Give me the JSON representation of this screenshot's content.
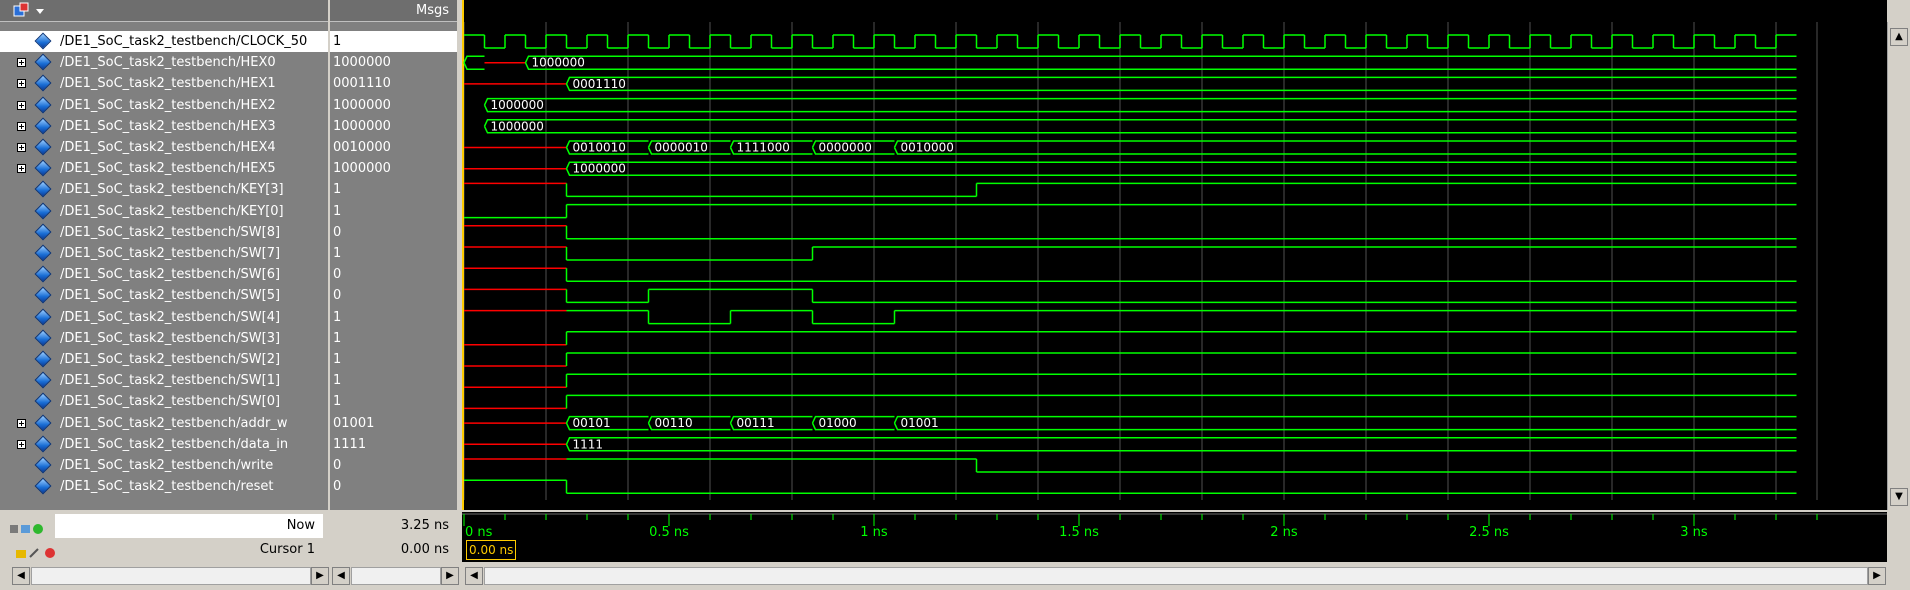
{
  "header": {
    "msgs_label": "Msgs"
  },
  "signals": [
    {
      "name": "/DE1_SoC_task2_testbench/CLOCK_50",
      "value": "1",
      "expandable": false,
      "selected": true
    },
    {
      "name": "/DE1_SoC_task2_testbench/HEX0",
      "value": "1000000",
      "expandable": true
    },
    {
      "name": "/DE1_SoC_task2_testbench/HEX1",
      "value": "0001110",
      "expandable": true
    },
    {
      "name": "/DE1_SoC_task2_testbench/HEX2",
      "value": "1000000",
      "expandable": true
    },
    {
      "name": "/DE1_SoC_task2_testbench/HEX3",
      "value": "1000000",
      "expandable": true
    },
    {
      "name": "/DE1_SoC_task2_testbench/HEX4",
      "value": "0010000",
      "expandable": true
    },
    {
      "name": "/DE1_SoC_task2_testbench/HEX5",
      "value": "1000000",
      "expandable": true
    },
    {
      "name": "/DE1_SoC_task2_testbench/KEY[3]",
      "value": "1",
      "expandable": false
    },
    {
      "name": "/DE1_SoC_task2_testbench/KEY[0]",
      "value": "1",
      "expandable": false
    },
    {
      "name": "/DE1_SoC_task2_testbench/SW[8]",
      "value": "0",
      "expandable": false
    },
    {
      "name": "/DE1_SoC_task2_testbench/SW[7]",
      "value": "1",
      "expandable": false
    },
    {
      "name": "/DE1_SoC_task2_testbench/SW[6]",
      "value": "0",
      "expandable": false
    },
    {
      "name": "/DE1_SoC_task2_testbench/SW[5]",
      "value": "0",
      "expandable": false
    },
    {
      "name": "/DE1_SoC_task2_testbench/SW[4]",
      "value": "1",
      "expandable": false
    },
    {
      "name": "/DE1_SoC_task2_testbench/SW[3]",
      "value": "1",
      "expandable": false
    },
    {
      "name": "/DE1_SoC_task2_testbench/SW[2]",
      "value": "1",
      "expandable": false
    },
    {
      "name": "/DE1_SoC_task2_testbench/SW[1]",
      "value": "1",
      "expandable": false
    },
    {
      "name": "/DE1_SoC_task2_testbench/SW[0]",
      "value": "1",
      "expandable": false
    },
    {
      "name": "/DE1_SoC_task2_testbench/addr_w",
      "value": "01001",
      "expandable": true
    },
    {
      "name": "/DE1_SoC_task2_testbench/data_in",
      "value": "1111",
      "expandable": true
    },
    {
      "name": "/DE1_SoC_task2_testbench/write",
      "value": "0",
      "expandable": false
    },
    {
      "name": "/DE1_SoC_task2_testbench/reset",
      "value": "0",
      "expandable": false
    }
  ],
  "bus_labels": {
    "hex0": [
      "1000000"
    ],
    "hex1": [
      "0001110"
    ],
    "hex2": [
      "1000000"
    ],
    "hex3": [
      "1000000"
    ],
    "hex4": [
      "0010010",
      "0000010",
      "1111000",
      "0000000",
      "0010000"
    ],
    "hex5": [
      "1000000"
    ],
    "addr_w": [
      "00101",
      "00110",
      "00111",
      "01000",
      "01001"
    ],
    "data_in": [
      "1111"
    ]
  },
  "status": {
    "now_label": "Now",
    "now_value": "3.25 ns",
    "cursor_label": "Cursor 1",
    "cursor_value": "0.00 ns",
    "cursor_marker": "0.00 ns"
  },
  "time_axis": {
    "ticks": [
      "0 ns",
      "0.5 ns",
      "1 ns",
      "1.5 ns",
      "2 ns",
      "2.5 ns",
      "3 ns"
    ]
  },
  "colors": {
    "wave": "#00ff00",
    "undefined": "#ff0000",
    "grid": "#505050",
    "cursor": "#ffcc00"
  }
}
